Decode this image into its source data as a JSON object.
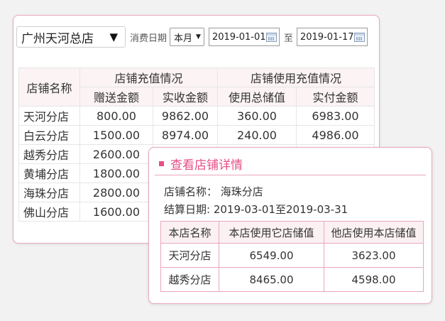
{
  "filters": {
    "store": "广州天河总店",
    "date_label": "消费日期",
    "period": "本月",
    "start_date": "2019-01-01",
    "to_label": "至",
    "end_date": "2019-01-17"
  },
  "stats_table": {
    "store_name_header": "店铺名称",
    "group1_header": "店铺充值情况",
    "group2_header": "店铺使用充值情况",
    "sub_headers": [
      "赠送金额",
      "实收金额",
      "使用总储值",
      "实付金额"
    ],
    "rows": [
      {
        "name": "天河分店",
        "gift": "800.00",
        "received": "9862.00",
        "used": "360.00",
        "paid": "6983.00"
      },
      {
        "name": "白云分店",
        "gift": "1500.00",
        "received": "8974.00",
        "used": "240.00",
        "paid": "4986.00"
      },
      {
        "name": "越秀分店",
        "gift": "2600.00"
      },
      {
        "name": "黄埔分店",
        "gift": "1800.00"
      },
      {
        "name": "海珠分店",
        "gift": "2800.00"
      },
      {
        "name": "佛山分店",
        "gift": "1600.00"
      }
    ]
  },
  "detail_popup": {
    "title": "查看店铺详情",
    "store_line": "店铺名称： 海珠分店",
    "period_line": "结算日期: 2019-03-01至2019-03-31",
    "headers": [
      "本店名称",
      "本店使用它店储值",
      "他店使用本店储值"
    ],
    "rows": [
      {
        "name": "天河分店",
        "used_other": "6549.00",
        "other_used": "3623.00"
      },
      {
        "name": "越秀分店",
        "used_other": "8465.00",
        "other_used": "4598.00"
      }
    ]
  },
  "colors": {
    "accent_pink": "#e74f86",
    "border_pink": "#e9a6bf",
    "header_bg": "#fbf3f4"
  }
}
